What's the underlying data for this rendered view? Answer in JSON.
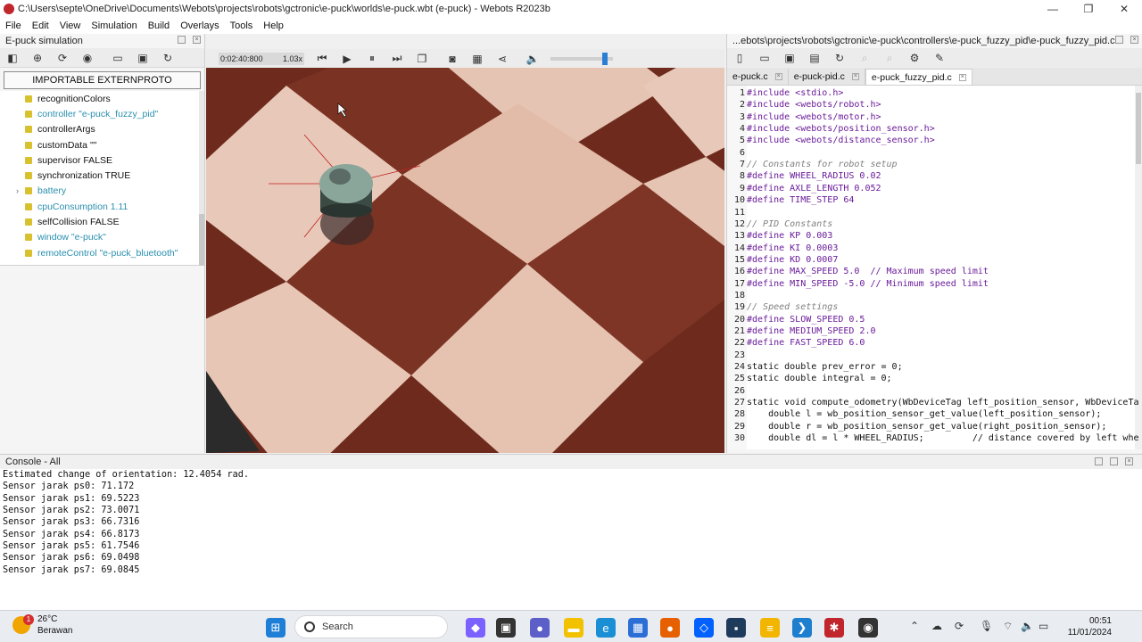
{
  "window": {
    "title": "C:\\Users\\septe\\OneDrive\\Documents\\Webots\\projects\\robots\\gctronic\\e-puck\\worlds\\e-puck.wbt (e-puck) - Webots R2023b",
    "minimize": "—",
    "maximize": "❐",
    "close": "✕"
  },
  "menu": [
    "File",
    "Edit",
    "View",
    "Simulation",
    "Build",
    "Overlays",
    "Tools",
    "Help"
  ],
  "left_panel": {
    "title": "E-puck simulation",
    "extern_button": "IMPORTABLE EXTERNPROTO",
    "tree": [
      {
        "label": "recognitionColors",
        "link": false
      },
      {
        "label": "controller \"e-puck_fuzzy_pid\"",
        "link": true
      },
      {
        "label": "controllerArgs",
        "link": false
      },
      {
        "label": "customData \"\"",
        "link": false
      },
      {
        "label": "supervisor FALSE",
        "link": false
      },
      {
        "label": "synchronization TRUE",
        "link": false
      },
      {
        "label": "battery",
        "link": true,
        "expandable": true
      },
      {
        "label": "cpuConsumption 1.11",
        "link": true
      },
      {
        "label": "selfCollision FALSE",
        "link": false
      },
      {
        "label": "window \"e-puck\"",
        "link": true
      },
      {
        "label": "remoteControl \"e-puck_bluetooth\"",
        "link": true
      }
    ]
  },
  "view_toolbar": {
    "time": "0:02:40:800",
    "speed": "1.03x",
    "volume_level": 0.9
  },
  "editor": {
    "title": "...ebots\\projects\\robots\\gctronic\\e-puck\\controllers\\e-puck_fuzzy_pid\\e-puck_fuzzy_pid.c",
    "tabs": [
      {
        "label": "e-puck.c",
        "active": false
      },
      {
        "label": "e-puck-pid.c",
        "active": false
      },
      {
        "label": "e-puck_fuzzy_pid.c",
        "active": true
      }
    ],
    "lines": [
      {
        "n": "1",
        "t": "#include <stdio.h>",
        "k": "pp"
      },
      {
        "n": "2",
        "t": "#include <webots/robot.h>",
        "k": "pp"
      },
      {
        "n": "3",
        "t": "#include <webots/motor.h>",
        "k": "pp"
      },
      {
        "n": "4",
        "t": "#include <webots/position_sensor.h>",
        "k": "pp"
      },
      {
        "n": "5",
        "t": "#include <webots/distance_sensor.h>",
        "k": "pp"
      },
      {
        "n": "6",
        "t": "",
        "k": ""
      },
      {
        "n": "7",
        "t": "// Constants for robot setup",
        "k": "cmt"
      },
      {
        "n": "8",
        "t": "#define WHEEL_RADIUS 0.02",
        "k": "pp"
      },
      {
        "n": "9",
        "t": "#define AXLE_LENGTH 0.052",
        "k": "pp"
      },
      {
        "n": "10",
        "t": "#define TIME_STEP 64",
        "k": "pp"
      },
      {
        "n": "11",
        "t": "",
        "k": ""
      },
      {
        "n": "12",
        "t": "// PID Constants",
        "k": "cmt"
      },
      {
        "n": "13",
        "t": "#define KP 0.003",
        "k": "pp"
      },
      {
        "n": "14",
        "t": "#define KI 0.0003",
        "k": "pp"
      },
      {
        "n": "15",
        "t": "#define KD 0.0007",
        "k": "pp"
      },
      {
        "n": "16",
        "t": "#define MAX_SPEED 5.0  // Maximum speed limit",
        "k": "pp"
      },
      {
        "n": "17",
        "t": "#define MIN_SPEED -5.0 // Minimum speed limit",
        "k": "pp"
      },
      {
        "n": "18",
        "t": "",
        "k": ""
      },
      {
        "n": "19",
        "t": "// Speed settings",
        "k": "cmt"
      },
      {
        "n": "20",
        "t": "#define SLOW_SPEED 0.5",
        "k": "pp"
      },
      {
        "n": "21",
        "t": "#define MEDIUM_SPEED 2.0",
        "k": "pp"
      },
      {
        "n": "22",
        "t": "#define FAST_SPEED 6.0",
        "k": "pp"
      },
      {
        "n": "23",
        "t": "",
        "k": ""
      },
      {
        "n": "24",
        "t": "static double prev_error = 0;",
        "k": ""
      },
      {
        "n": "25",
        "t": "static double integral = 0;",
        "k": ""
      },
      {
        "n": "26",
        "t": "",
        "k": ""
      },
      {
        "n": "27",
        "t": "static void compute_odometry(WbDeviceTag left_position_sensor, WbDeviceTa",
        "k": ""
      },
      {
        "n": "28",
        "t": "    double l = wb_position_sensor_get_value(left_position_sensor);",
        "k": ""
      },
      {
        "n": "29",
        "t": "    double r = wb_position_sensor_get_value(right_position_sensor);",
        "k": ""
      },
      {
        "n": "30",
        "t": "    double dl = l * WHEEL_RADIUS;         // distance covered by left whe",
        "k": ""
      }
    ]
  },
  "console": {
    "title": "Console - All",
    "lines": [
      "Estimated change of orientation: 12.4054 rad.",
      "Sensor jarak ps0: 71.172",
      "Sensor jarak ps1: 69.5223",
      "Sensor jarak ps2: 73.0071",
      "Sensor jarak ps3: 66.7316",
      "Sensor jarak ps4: 66.8173",
      "Sensor jarak ps5: 61.7546",
      "Sensor jarak ps6: 69.0498",
      "Sensor jarak ps7: 69.0845"
    ]
  },
  "taskbar": {
    "weather_temp": "26°C",
    "weather_desc": "Berawan",
    "weather_badge": "1",
    "search_label": "Search",
    "time": "00:51",
    "date": "11/01/2024"
  }
}
